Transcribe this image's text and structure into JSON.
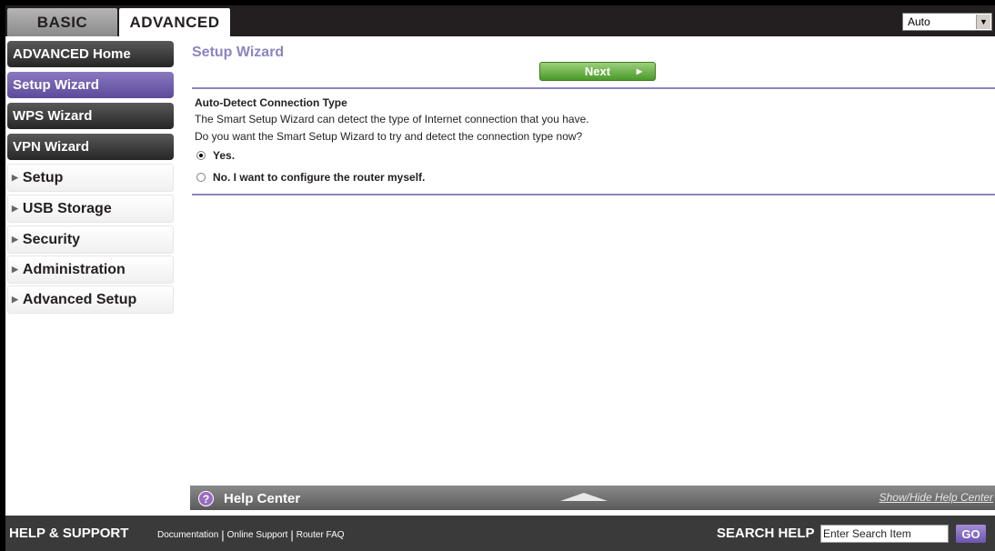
{
  "tabs": {
    "basic": "BASIC",
    "advanced": "ADVANCED"
  },
  "language": {
    "selected": "Auto"
  },
  "sidebar": {
    "main_items": [
      {
        "label": "ADVANCED Home",
        "active": false
      },
      {
        "label": "Setup Wizard",
        "active": true
      },
      {
        "label": "WPS Wizard",
        "active": false
      },
      {
        "label": "VPN Wizard",
        "active": false
      }
    ],
    "sections": [
      {
        "label": "Setup"
      },
      {
        "label": "USB Storage"
      },
      {
        "label": "Security"
      },
      {
        "label": "Administration"
      },
      {
        "label": "Advanced Setup"
      }
    ]
  },
  "main": {
    "title": "Setup Wizard",
    "next_label": "Next",
    "section_title": "Auto-Detect Connection Type",
    "desc1": "The Smart Setup Wizard can detect the type of Internet connection that you have.",
    "desc2": "Do you want the Smart Setup Wizard to try and detect the connection type now?",
    "option_yes": "Yes.",
    "option_no": "No. I want to configure the router myself.",
    "selected_option": "yes"
  },
  "help_center": {
    "title": "Help Center",
    "toggle_label": "Show/Hide Help Center"
  },
  "footer": {
    "title": "HELP & SUPPORT",
    "links": [
      "Documentation",
      "Online Support",
      "Router FAQ"
    ],
    "search_label": "SEARCH HELP",
    "search_value": "Enter Search Item",
    "go_label": "GO"
  },
  "colors": {
    "accent_purple": "#8b85c1",
    "active_nav": "#6f5fae",
    "next_green": "#5aa83a"
  }
}
